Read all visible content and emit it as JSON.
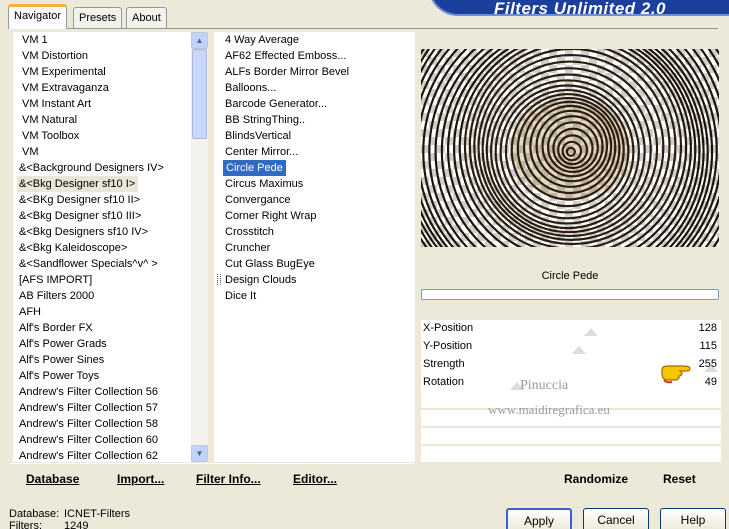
{
  "banner": {
    "title": "Filters Unlimited 2.0"
  },
  "tabs": [
    {
      "label": "Navigator",
      "active": true
    },
    {
      "label": "Presets",
      "active": false
    },
    {
      "label": "About",
      "active": false
    }
  ],
  "categories": [
    "VM 1",
    "VM Distortion",
    "VM Experimental",
    "VM Extravaganza",
    "VM Instant Art",
    "VM Natural",
    "VM Toolbox",
    "VM",
    "&<Background Designers IV>",
    "&<Bkg Designer sf10 I>",
    "&<BKg Designer sf10 II>",
    "&<Bkg Designer sf10 III>",
    "&<Bkg Designers sf10 IV>",
    "&<Bkg Kaleidoscope>",
    "&<Sandflower Specials^v^ >",
    "[AFS IMPORT]",
    "AB Filters 2000",
    "AFH",
    "Alf's Border FX",
    "Alf's Power Grads",
    "Alf's Power Sines",
    "Alf's Power Toys",
    "Andrew's Filter Collection 56",
    "Andrew's Filter Collection 57",
    "Andrew's Filter Collection 58",
    "Andrew's Filter Collection 60",
    "Andrew's Filter Collection 62"
  ],
  "categories_selected_index": 9,
  "filters": [
    "4 Way Average",
    "AF62 Effected Emboss...",
    "ALFs Border Mirror Bevel",
    "Balloons...",
    "Barcode Generator...",
    "BB StringThing..",
    "BlindsVertical",
    "Center Mirror...",
    "Circle Pede",
    "Circus Maximus",
    "Convergance",
    "Corner Right Wrap",
    "Crosstitch",
    "Cruncher",
    "Cut Glass  BugEye",
    "Design Clouds",
    "Dice It"
  ],
  "filters_selected_index": 8,
  "effect_name": "Circle Pede",
  "sliders": [
    {
      "label": "X-Position",
      "value": "128",
      "level": 128
    },
    {
      "label": "Y-Position",
      "value": "115",
      "level": 115
    },
    {
      "label": "Strength",
      "value": "255",
      "level": 255
    },
    {
      "label": "Rotation",
      "value": "49",
      "level": 49
    }
  ],
  "watermark": {
    "line1": "Pinuccia",
    "line2": "www.maidiregrafica.eu"
  },
  "left_buttons": {
    "database": "Database",
    "import": "Import...",
    "filter_info": "Filter Info...",
    "editor": "Editor..."
  },
  "right_buttons": {
    "randomize": "Randomize",
    "reset": "Reset"
  },
  "dialog_buttons": {
    "apply": "Apply",
    "cancel": "Cancel",
    "help": "Help"
  },
  "status": {
    "database_label": "Database:",
    "database_value": "ICNET-Filters",
    "filters_label": "Filters:",
    "filters_value": "1249"
  },
  "colors": {
    "accent_tab": "#f4b23b",
    "selection": "#316ac5",
    "banner": "#1a3f9c"
  }
}
